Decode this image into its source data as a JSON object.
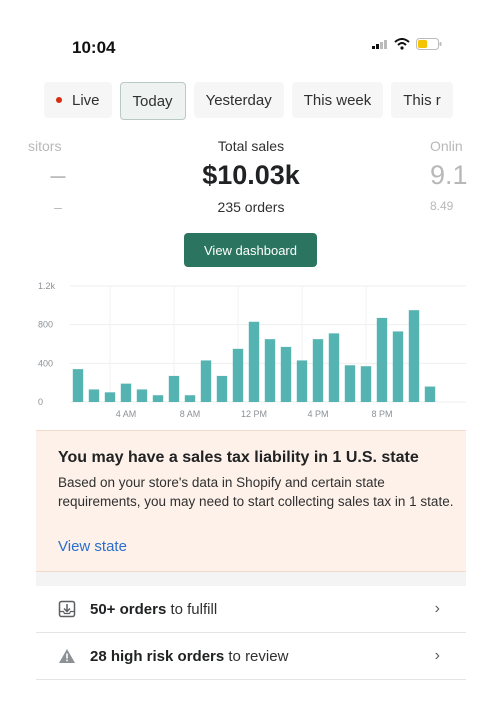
{
  "status": {
    "time": "10:04"
  },
  "tabs": [
    {
      "label": "Live",
      "live": true
    },
    {
      "label": "Today",
      "active": true
    },
    {
      "label": "Yesterday"
    },
    {
      "label": "This week"
    },
    {
      "label": "This r"
    }
  ],
  "metrics": {
    "left": {
      "label": "sitors",
      "value": "–",
      "sub": "–"
    },
    "center": {
      "label": "Total sales",
      "value": "$10.03k",
      "sub": "235 orders"
    },
    "right": {
      "label": "Onlin",
      "value": "9.1",
      "sub": "8.49"
    }
  },
  "dashboard_button": "View dashboard",
  "chart_data": {
    "type": "bar",
    "x_tick_labels": [
      "4 AM",
      "8 AM",
      "12 PM",
      "4 PM",
      "8 PM"
    ],
    "y_tick_labels": [
      "0",
      "400",
      "800",
      "1.2k"
    ],
    "ylim": [
      0,
      1200
    ],
    "values": [
      340,
      130,
      100,
      190,
      130,
      70,
      270,
      70,
      430,
      270,
      550,
      830,
      650,
      570,
      430,
      650,
      710,
      380,
      370,
      870,
      730,
      950,
      160
    ],
    "color": "#55b3b1",
    "grid": true
  },
  "alert": {
    "title": "You may have a sales tax liability in 1 U.S. state",
    "body": "Based on your store's data in Shopify and certain state requirements, you may need to start collecting sales tax in 1 state.",
    "link": "View state"
  },
  "tasks": [
    {
      "icon": "fulfill-box-icon",
      "bold": "50+ orders",
      "rest": " to fulfill"
    },
    {
      "icon": "warning-triangle-icon",
      "bold": "28 high risk orders",
      "rest": " to review"
    }
  ]
}
